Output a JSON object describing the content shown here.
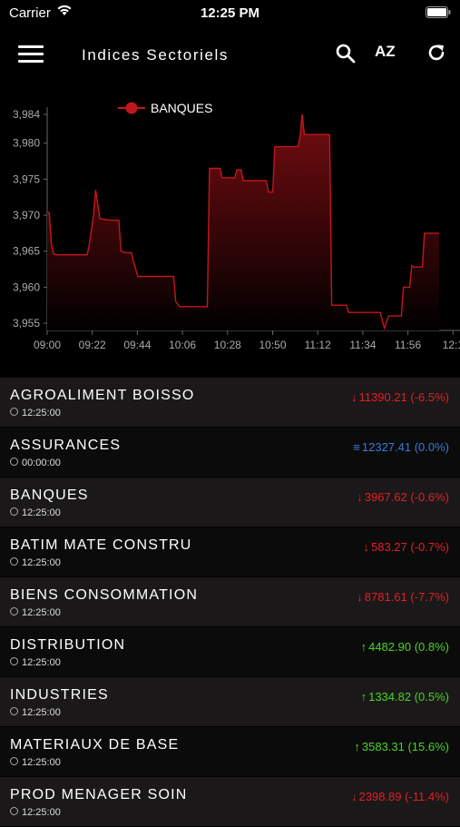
{
  "status_bar": {
    "carrier": "Carrier",
    "time": "12:25 PM"
  },
  "header": {
    "title": "Indices Sectoriels",
    "sort_label": "AZ"
  },
  "colors": {
    "down": "#e0202a",
    "up": "#4bd325",
    "flat": "#3a7bd5",
    "series": "#c3161c"
  },
  "icons": [
    "menu-icon",
    "search-icon",
    "sort-az-icon",
    "refresh-icon",
    "clock-icon"
  ],
  "chart_data": {
    "type": "area",
    "series_name": "BANQUES",
    "x_ticks": [
      "09:00",
      "09:22",
      "09:44",
      "10:06",
      "10:28",
      "10:50",
      "11:12",
      "11:34",
      "11:56",
      "12:1"
    ],
    "y_ticks": [
      "3,955",
      "3,960",
      "3,965",
      "3,970",
      "3,975",
      "3,980",
      "3,984"
    ],
    "ylim": [
      3954,
      3985
    ],
    "points": [
      [
        "09:00",
        3970.5
      ],
      [
        "09:01",
        3970.3
      ],
      [
        "09:02",
        3966
      ],
      [
        "09:03",
        3964.6
      ],
      [
        "09:05",
        3964.5
      ],
      [
        "09:10",
        3964.5
      ],
      [
        "09:19",
        3964.5
      ],
      [
        "09:20",
        3966
      ],
      [
        "09:21",
        3968
      ],
      [
        "09:22",
        3970
      ],
      [
        "09:23",
        3973.5
      ],
      [
        "09:24",
        3971.5
      ],
      [
        "09:25",
        3969.5
      ],
      [
        "09:30",
        3969.3
      ],
      [
        "09:34",
        3969.3
      ],
      [
        "09:35",
        3965
      ],
      [
        "09:37",
        3964.8
      ],
      [
        "09:40",
        3964.8
      ],
      [
        "09:41",
        3963.5
      ],
      [
        "09:43",
        3961.5
      ],
      [
        "09:50",
        3961.5
      ],
      [
        "10:00",
        3961.5
      ],
      [
        "10:01",
        3958
      ],
      [
        "10:03",
        3957.3
      ],
      [
        "10:10",
        3957.3
      ],
      [
        "10:16",
        3957.3
      ],
      [
        "10:17",
        3976.5
      ],
      [
        "10:22",
        3976.5
      ],
      [
        "10:23",
        3975.2
      ],
      [
        "10:29",
        3975.2
      ],
      [
        "10:30",
        3976.3
      ],
      [
        "10:32",
        3976.3
      ],
      [
        "10:33",
        3974.8
      ],
      [
        "10:44",
        3974.8
      ],
      [
        "10:45",
        3973.2
      ],
      [
        "10:47",
        3973.2
      ],
      [
        "10:48",
        3979.5
      ],
      [
        "10:59",
        3979.5
      ],
      [
        "11:00",
        3981
      ],
      [
        "11:01",
        3984
      ],
      [
        "11:02",
        3981.2
      ],
      [
        "11:14",
        3981.2
      ],
      [
        "11:15",
        3957.5
      ],
      [
        "11:22",
        3957.5
      ],
      [
        "11:23",
        3956.5
      ],
      [
        "11:38",
        3956.5
      ],
      [
        "11:40",
        3954.3
      ],
      [
        "11:42",
        3956
      ],
      [
        "11:48",
        3956
      ],
      [
        "11:49",
        3960
      ],
      [
        "11:52",
        3960
      ],
      [
        "11:53",
        3963
      ],
      [
        "11:54",
        3962.8
      ],
      [
        "11:58",
        3962.8
      ],
      [
        "11:59",
        3967.5
      ],
      [
        "12:06",
        3967.5
      ]
    ]
  },
  "sectors": [
    {
      "name": "AGROALIMENT BOISSO",
      "time": "12:25:00",
      "dir": "down",
      "value": "11390.21 (-6.5%)"
    },
    {
      "name": "ASSURANCES",
      "time": "00:00:00",
      "dir": "flat",
      "value": "12327.41 (0.0%)"
    },
    {
      "name": "BANQUES",
      "time": "12:25:00",
      "dir": "down",
      "value": "3967.62 (-0.6%)"
    },
    {
      "name": "BATIM MATE CONSTRU",
      "time": "12:25:00",
      "dir": "down",
      "value": "583.27 (-0.7%)"
    },
    {
      "name": "BIENS CONSOMMATION",
      "time": "12:25:00",
      "dir": "down",
      "value": "8781.61 (-7.7%)"
    },
    {
      "name": "DISTRIBUTION",
      "time": "12:25:00",
      "dir": "up",
      "value": "4482.90 (0.8%)"
    },
    {
      "name": "INDUSTRIES",
      "time": "12:25:00",
      "dir": "up",
      "value": "1334.82 (0.5%)"
    },
    {
      "name": "MATERIAUX DE BASE",
      "time": "12:25:00",
      "dir": "up",
      "value": "3583.31 (15.6%)"
    },
    {
      "name": "PROD MENAGER SOIN",
      "time": "12:25:00",
      "dir": "down",
      "value": "2398.89 (-11.4%)"
    }
  ]
}
